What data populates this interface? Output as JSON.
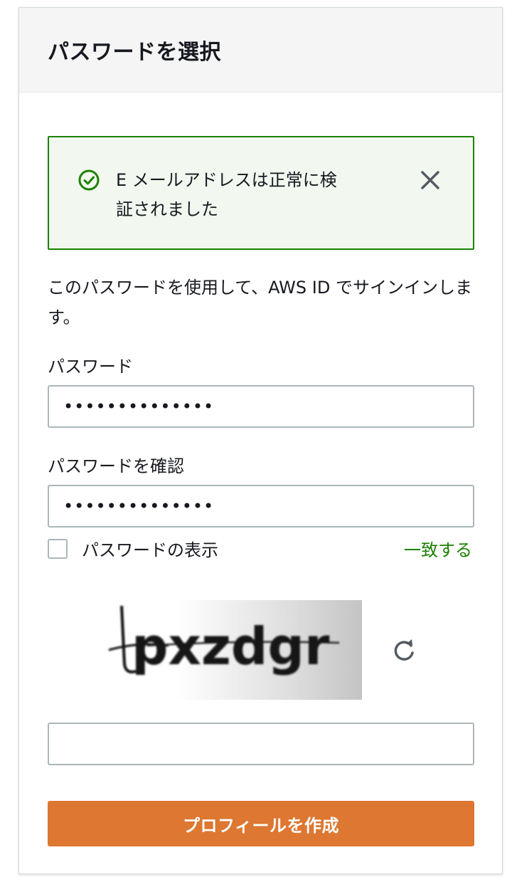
{
  "header": {
    "title": "パスワードを選択"
  },
  "alert": {
    "message": "E メールアドレスは正常に検証されました",
    "icon": "check-circle-icon",
    "close_icon": "close-icon",
    "color": "#1d8102"
  },
  "intro": {
    "text": "このパスワードを使用して、AWS ID でサインインします。"
  },
  "password": {
    "label": "パスワード",
    "value": "••••••••••••••"
  },
  "confirm_password": {
    "label": "パスワードを確認",
    "value": "••••••••••••••"
  },
  "show_password": {
    "label": "パスワードの表示",
    "checked": false
  },
  "match_status": {
    "text": "一致する",
    "color": "#1d8102"
  },
  "captcha": {
    "text": "pxzdgr",
    "refresh_icon": "refresh-icon",
    "input_value": ""
  },
  "submit": {
    "label": "プロフィールを作成",
    "color": "#dd7731"
  }
}
